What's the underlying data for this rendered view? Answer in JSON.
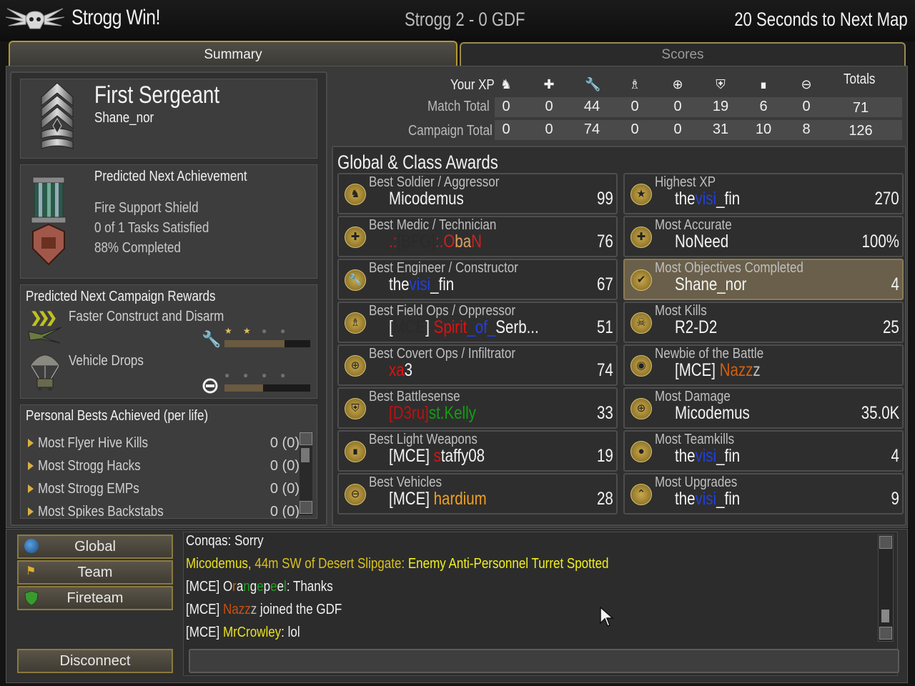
{
  "header": {
    "left_title": "Strogg Win!",
    "center_title": "Strogg 2 - 0 GDF",
    "right_title": "20 Seconds to Next Map"
  },
  "tabs": [
    {
      "label": "Summary",
      "active": true
    },
    {
      "label": "Scores",
      "active": false
    }
  ],
  "rank": {
    "title": "First Sergeant",
    "player": "Shane_nor"
  },
  "achievement": {
    "heading": "Predicted Next Achievement",
    "name": "Fire Support Shield",
    "tasks": "0 of 1 Tasks Satisfied",
    "completed": "88% Completed"
  },
  "campaign": {
    "heading": "Predicted Next Campaign Rewards",
    "rewards": [
      {
        "label": "Faster Construct and Disarm",
        "icon": "wrench-icon",
        "stars": [
          1,
          1,
          0,
          0
        ],
        "progress": 0.7
      },
      {
        "label": "Vehicle Drops",
        "icon": "minus-circle-icon",
        "stars": [
          0,
          0,
          0,
          0
        ],
        "progress": 0.45
      }
    ]
  },
  "personal_bests": {
    "heading": "Personal Bests Achieved (per life)",
    "items": [
      {
        "label": "Most Flyer Hive Kills",
        "value": "0 (0)"
      },
      {
        "label": "Most Strogg Hacks",
        "value": "0 (0)"
      },
      {
        "label": "Most Strogg EMPs",
        "value": "0 (0)"
      },
      {
        "label": "Most Spikes Backstabs",
        "value": "0 (0)"
      }
    ]
  },
  "xp": {
    "your_xp": "Your XP",
    "totals": "Totals",
    "icons": [
      "soldier-icon",
      "medic-cross-icon",
      "wrench-icon",
      "fieldops-icon",
      "crosshair-icon",
      "shield-icon",
      "gun-icon",
      "minus-circle-icon"
    ],
    "rows": [
      {
        "label": "Match Total",
        "values": [
          "0",
          "0",
          "44",
          "0",
          "0",
          "19",
          "6",
          "0"
        ],
        "total": "71"
      },
      {
        "label": "Campaign Total",
        "values": [
          "0",
          "0",
          "74",
          "0",
          "0",
          "31",
          "10",
          "8"
        ],
        "total": "126"
      }
    ]
  },
  "awards": {
    "heading": "Global & Class Awards",
    "left": [
      {
        "category": "Best Soldier / Aggressor",
        "who": [
          {
            "t": "Micodemus",
            "c": "#f3f3f3"
          }
        ],
        "value": "99",
        "icon": "soldier-icon",
        "highlight": false
      },
      {
        "category": "Best Medic / Technician",
        "who": [
          {
            "t": ".:",
            "c": "#c02020"
          },
          {
            "t": "[BFG]",
            "c": "#2a2a2a"
          },
          {
            "t": ":.",
            "c": "#c02020"
          },
          {
            "t": "O",
            "c": "#d02020"
          },
          {
            "t": "ba",
            "c": "#e0a060"
          },
          {
            "t": "N",
            "c": "#d02020"
          }
        ],
        "value": "76",
        "icon": "medic-cross-icon",
        "highlight": false
      },
      {
        "category": "Best Engineer / Constructor",
        "who": [
          {
            "t": "the",
            "c": "#f3f3f3"
          },
          {
            "t": "visi",
            "c": "#2040e0"
          },
          {
            "t": "_fin",
            "c": "#f3f3f3"
          }
        ],
        "value": "67",
        "icon": "wrench-icon",
        "highlight": false
      },
      {
        "category": "Best Field Ops / Oppressor",
        "who": [
          {
            "t": "[",
            "c": "#f3f3f3"
          },
          {
            "t": "MCE",
            "c": "#2a2a2a"
          },
          {
            "t": "] ",
            "c": "#f3f3f3"
          },
          {
            "t": "Spirit",
            "c": "#e01010"
          },
          {
            "t": "_of_",
            "c": "#2040e0"
          },
          {
            "t": "Serb...",
            "c": "#f3f3f3"
          }
        ],
        "value": "51",
        "icon": "fieldops-icon",
        "highlight": false
      },
      {
        "category": "Best Covert Ops / Infiltrator",
        "who": [
          {
            "t": "xa",
            "c": "#e01010"
          },
          {
            "t": "3",
            "c": "#f3f3f3"
          }
        ],
        "value": "74",
        "icon": "crosshair-icon",
        "highlight": false
      },
      {
        "category": "Best Battlesense",
        "who": [
          {
            "t": "[D3ru]",
            "c": "#c01010"
          },
          {
            "t": "st.Kelly",
            "c": "#10a010"
          }
        ],
        "value": "33",
        "icon": "shield-icon",
        "highlight": false
      },
      {
        "category": "Best Light Weapons",
        "who": [
          {
            "t": "[MCE] ",
            "c": "#f3f3f3"
          },
          {
            "t": "s",
            "c": "#e01010"
          },
          {
            "t": "taffy08",
            "c": "#f3f3f3"
          }
        ],
        "value": "19",
        "icon": "gun-icon",
        "highlight": false
      },
      {
        "category": "Best Vehicles",
        "who": [
          {
            "t": "[MCE] ",
            "c": "#f3f3f3"
          },
          {
            "t": "hardium",
            "c": "#f0a020"
          }
        ],
        "value": "28",
        "icon": "minus-circle-icon",
        "highlight": false
      }
    ],
    "right": [
      {
        "category": "Highest XP",
        "who": [
          {
            "t": "the",
            "c": "#f3f3f3"
          },
          {
            "t": "visi",
            "c": "#2040e0"
          },
          {
            "t": "_fin",
            "c": "#f3f3f3"
          }
        ],
        "value": "270",
        "icon": "star-icon",
        "highlight": false
      },
      {
        "category": "Most Accurate",
        "who": [
          {
            "t": "NoNeed",
            "c": "#f3f3f3"
          }
        ],
        "value": "100%",
        "icon": "medic-cross-icon",
        "highlight": false
      },
      {
        "category": "Most Objectives Completed",
        "who": [
          {
            "t": "Shane_nor",
            "c": "#f3f3f3"
          }
        ],
        "value": "4",
        "icon": "check-icon",
        "highlight": true
      },
      {
        "category": "Most Kills",
        "who": [
          {
            "t": "R2-D2",
            "c": "#f3f3f3"
          }
        ],
        "value": "25",
        "icon": "skull-icon",
        "highlight": false
      },
      {
        "category": "Newbie of the Battle",
        "who": [
          {
            "t": "[MCE] ",
            "c": "#f3f3f3"
          },
          {
            "t": "Nazz",
            "c": "#d06010"
          },
          {
            "t": "z",
            "c": "#c0c0c0"
          }
        ],
        "value": "",
        "icon": "helmet-icon",
        "highlight": false
      },
      {
        "category": "Most Damage",
        "who": [
          {
            "t": "Micodemus",
            "c": "#f3f3f3"
          }
        ],
        "value": "35.0K",
        "icon": "crosshair-icon",
        "highlight": false
      },
      {
        "category": "Most Teamkills",
        "who": [
          {
            "t": "the",
            "c": "#f3f3f3"
          },
          {
            "t": "visi",
            "c": "#2040e0"
          },
          {
            "t": "_fin",
            "c": "#f3f3f3"
          }
        ],
        "value": "4",
        "icon": "teamkill-icon",
        "highlight": false
      },
      {
        "category": "Most Upgrades",
        "who": [
          {
            "t": "the",
            "c": "#f3f3f3"
          },
          {
            "t": "visi",
            "c": "#2040e0"
          },
          {
            "t": "_fin",
            "c": "#f3f3f3"
          }
        ],
        "value": "9",
        "icon": "chevron-up-icon",
        "highlight": false
      }
    ]
  },
  "channels": [
    {
      "label": "Global",
      "icon": "globe-icon"
    },
    {
      "label": "Team",
      "icon": "flag-icon"
    },
    {
      "label": "Fireteam",
      "icon": "shield-icon"
    }
  ],
  "disconnect_label": "Disconnect",
  "chat": [
    [
      {
        "t": "Conqas: Sorry",
        "c": "#f0f0f0"
      }
    ],
    [
      {
        "t": "Micodemus, ",
        "c": "#e8e020"
      },
      {
        "t": "44m SW of Desert Slipgate: ",
        "c": "#d8c020"
      },
      {
        "t": "Enemy Anti-Personnel Turret Spotted",
        "c": "#f0f020"
      }
    ],
    [
      {
        "t": "[MCE] ",
        "c": "#f0f0f0"
      },
      {
        "t": "O",
        "c": "#f0f0f0"
      },
      {
        "t": "r",
        "c": "#c06010"
      },
      {
        "t": "a",
        "c": "#f0f0f0"
      },
      {
        "t": "n",
        "c": "#20a020"
      },
      {
        "t": "g",
        "c": "#f0f0f0"
      },
      {
        "t": "e",
        "c": "#20a020"
      },
      {
        "t": "p",
        "c": "#f0f0f0"
      },
      {
        "t": "e",
        "c": "#20a020"
      },
      {
        "t": "e",
        "c": "#f0f0f0"
      },
      {
        "t": "l",
        "c": "#20a020"
      },
      {
        "t": ": Thanks",
        "c": "#f0f0f0"
      }
    ],
    [
      {
        "t": "[MCE] ",
        "c": "#f0f0f0"
      },
      {
        "t": "Nazz",
        "c": "#c85010"
      },
      {
        "t": "z ",
        "c": "#bbbbbb"
      },
      {
        "t": "joined the GDF",
        "c": "#f0f0f0"
      }
    ],
    [
      {
        "t": "[MCE] ",
        "c": "#f0f0f0"
      },
      {
        "t": "MrCrowley",
        "c": "#e8e020"
      },
      {
        "t": ": lol",
        "c": "#f0f0f0"
      }
    ]
  ]
}
